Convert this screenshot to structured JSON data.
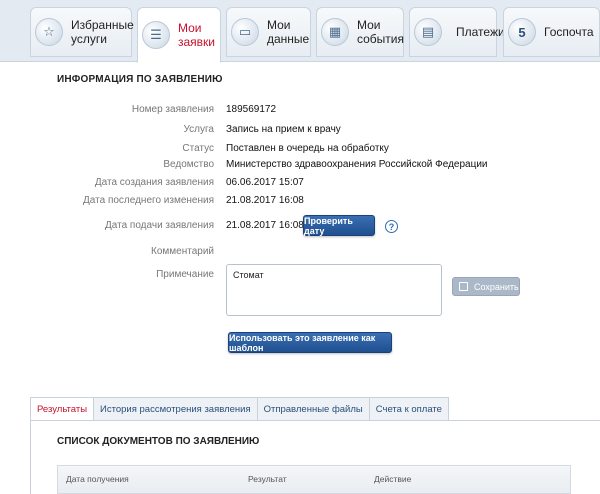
{
  "nav": {
    "tabs": [
      {
        "label": "Избранные\nуслуги",
        "icon": "favorites-icon"
      },
      {
        "label": "Мои\nзаявки",
        "icon": "list-icon"
      },
      {
        "label": "Мои\nданные",
        "icon": "id-card-icon"
      },
      {
        "label": "Мои\nсобытия",
        "icon": "calendar-icon"
      },
      {
        "label": "Платежи",
        "icon": "payment-icon"
      },
      {
        "label": "Госпочта",
        "icon": "mail-icon",
        "badge": "5"
      }
    ]
  },
  "info": {
    "title": "ИНФОРМАЦИЯ ПО ЗАЯВЛЕНИЮ",
    "fields": [
      {
        "label": "Номер заявления",
        "value": "189569172"
      },
      {
        "label": "Услуга",
        "value": "Запись на прием к врачу"
      },
      {
        "label": "Статус",
        "value": "Поставлен в очередь на обработку"
      },
      {
        "label": "Ведомство",
        "value": "Министерство здравоохранения Российской Федерации"
      },
      {
        "label": "Дата создания заявления",
        "value": "06.06.2017 15:07"
      },
      {
        "label": "Дата последнего изменения",
        "value": "21.08.2017 16:08"
      },
      {
        "label": "Дата подачи заявления",
        "value": "21.08.2017 16:08"
      }
    ],
    "check_date_label": "Проверить дату",
    "help_glyph": "?",
    "comment_label": "Комментарий",
    "note_label": "Примечание",
    "note_value": "Стомат",
    "save_label": "Сохранить",
    "template_label": "Использовать это заявление как шаблон"
  },
  "subtabs": [
    {
      "label": "Результаты",
      "active": true
    },
    {
      "label": "История рассмотрения заявления"
    },
    {
      "label": "Отправленные файлы"
    },
    {
      "label": "Счета к оплате"
    }
  ],
  "docs": {
    "title": "СПИСОК ДОКУМЕНТОВ ПО ЗАЯВЛЕНИЮ",
    "columns": [
      "Дата получения",
      "Результат",
      "Действие"
    ]
  },
  "colors": {
    "accent_red": "#c8102e",
    "button_blue": "#1f4f8f",
    "link_blue": "#2a4f7a"
  }
}
